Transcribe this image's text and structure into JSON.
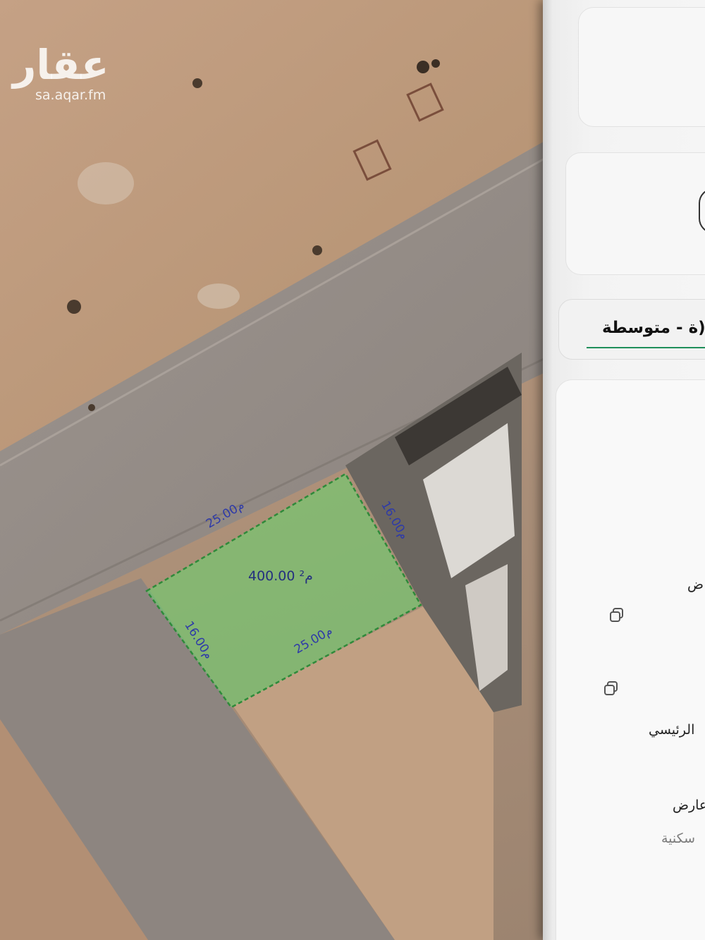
{
  "watermark": {
    "logo": "عقار",
    "url": "sa.aqar.fm"
  },
  "plot": {
    "area_label": "400.00 م²",
    "side_top": "25.00م",
    "side_bottom": "25.00م",
    "side_left": "16.00م",
    "side_right": "16.00م",
    "fill_color": "#6fcf6f",
    "border_color": "#2f8a3a"
  },
  "panel": {
    "select_value": "ة - متوسطة)",
    "accent_color": "#1f8f5a",
    "rows": [
      {
        "text": "ض"
      },
      {
        "text": "الرئيسي"
      },
      {
        "text": "عارض"
      },
      {
        "text": "سكنية"
      }
    ],
    "copy_icons": [
      "copy-icon",
      "copy-icon"
    ]
  }
}
